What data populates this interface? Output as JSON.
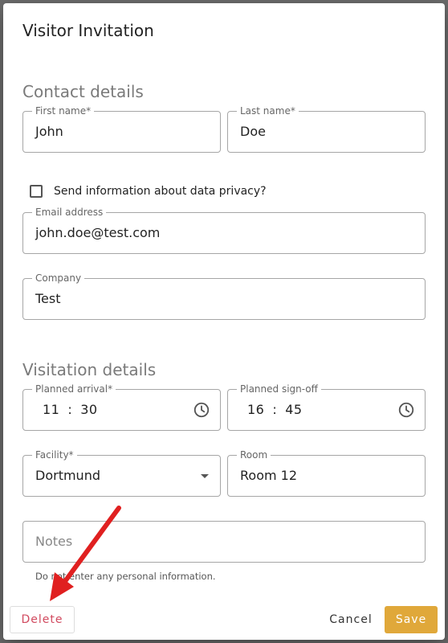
{
  "dialog": {
    "title": "Visitor Invitation"
  },
  "contact": {
    "heading": "Contact details",
    "first_name": {
      "label": "First name*",
      "value": "John"
    },
    "last_name": {
      "label": "Last name*",
      "value": "Doe"
    },
    "privacy_checkbox": {
      "label": "Send information about data privacy?",
      "checked": false
    },
    "email": {
      "label": "Email address",
      "value": "john.doe@test.com"
    },
    "company": {
      "label": "Company",
      "value": "Test"
    }
  },
  "visitation": {
    "heading": "Visitation details",
    "arrival": {
      "label": "Planned arrival*",
      "hour": "11",
      "minute": "30",
      "icon": "clock-icon"
    },
    "signoff": {
      "label": "Planned sign-off",
      "hour": "16",
      "minute": "45",
      "icon": "clock-icon"
    },
    "facility": {
      "label": "Facility*",
      "value": "Dortmund",
      "icon": "dropdown-caret-icon"
    },
    "room": {
      "label": "Room",
      "value": "Room 12"
    },
    "notes": {
      "placeholder": "Notes",
      "helper": "Do not enter any personal information."
    }
  },
  "actions": {
    "delete_label": "Delete",
    "cancel_label": "Cancel",
    "save_label": "Save"
  },
  "colors": {
    "accent": "#e0a83a",
    "delete_text": "#d14a5f",
    "annotation_arrow": "#e02020"
  }
}
